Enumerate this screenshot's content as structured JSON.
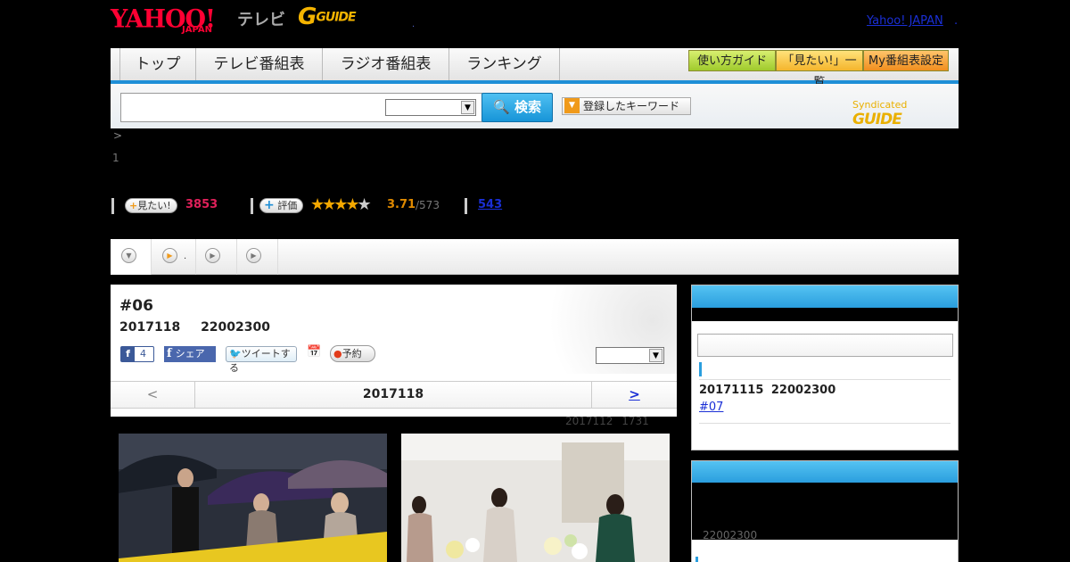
{
  "header": {
    "logo_yahoo": "YAHOO!",
    "logo_japan": "JAPAN",
    "logo_tv": "テレビ",
    "logo_gguide": "G",
    "logo_gguide_suffix": "GUIDE",
    "dot": ".",
    "yahoo_link": "Yahoo! JAPAN",
    "yahoo_link_dot": "."
  },
  "nav": {
    "tabs": [
      {
        "label": "トップ"
      },
      {
        "label": "テレビ番組表"
      },
      {
        "label": "ラジオ番組表"
      },
      {
        "label": "ランキング"
      }
    ],
    "guide_buttons": [
      {
        "label": "使い方ガイド"
      },
      {
        "label": "「見たい!」一覧"
      },
      {
        "label": "My番組表設定"
      }
    ]
  },
  "search": {
    "input_value": "",
    "select_value": "",
    "button_label": "検索",
    "keyword_button_label": "登録したキーワード",
    "syndicated_label": "Syndicated",
    "syndicated_logo": "GUIDE"
  },
  "breadcrumb": ">",
  "count_line": "1",
  "stats": {
    "mitai_label": "見たい!",
    "mitai_count": "3853",
    "hyouka_label": "評価",
    "stars_filled": "★★★★",
    "stars_empty": "★",
    "rating": "3.71",
    "rating_total": "/573",
    "review_count": "543"
  },
  "tabs_bar": {
    "tab2_label": "."
  },
  "episode": {
    "title": "#06",
    "datetime": "2017118 22002300",
    "fb_count": "4",
    "fb_share_label": "シェア",
    "tweet_label": "ツイートする",
    "reserve_label": "予約",
    "select_value": "",
    "pager_prev": "<",
    "pager_date": "2017118",
    "pager_next": ">",
    "update_note": "2017112 1731"
  },
  "sidebar": {
    "next_date": "20171115 22002300",
    "next_link": "#07",
    "bottom_time": "22002300"
  },
  "colors": {
    "accent_blue": "#1f8fd6",
    "brand_red": "#ff0033",
    "gguide_yellow": "#f5b400",
    "count_pink": "#e0205a",
    "star_orange": "#f4a800"
  }
}
